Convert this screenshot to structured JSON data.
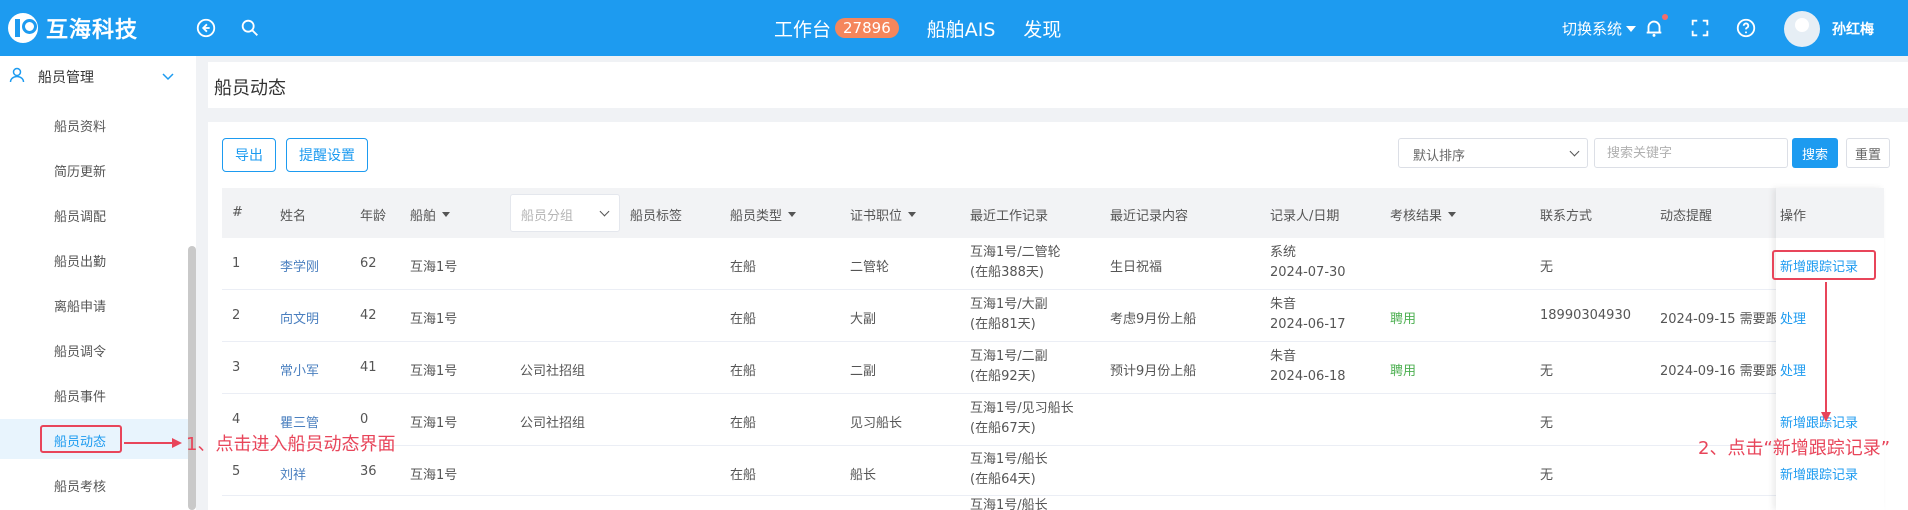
{
  "header": {
    "logo_text": "互海科技",
    "nav": [
      {
        "label": "工作台",
        "badge": "27896"
      },
      {
        "label": "船舶AIS"
      },
      {
        "label": "发现"
      }
    ],
    "switch_system": "切换系统",
    "username": "孙红梅"
  },
  "sidebar": {
    "group_label": "船员管理",
    "items": [
      {
        "label": "船员资料"
      },
      {
        "label": "简历更新"
      },
      {
        "label": "船员调配"
      },
      {
        "label": "船员出勤"
      },
      {
        "label": "离船申请"
      },
      {
        "label": "船员调令"
      },
      {
        "label": "船员事件"
      },
      {
        "label": "船员动态",
        "active": true
      },
      {
        "label": "船员考核"
      }
    ]
  },
  "page": {
    "title": "船员动态"
  },
  "toolbar": {
    "export_label": "导出",
    "reminder_label": "提醒设置",
    "sort_value": "默认排序",
    "search_placeholder": "搜索关键字",
    "search_label": "搜索",
    "reset_label": "重置"
  },
  "table": {
    "headers": {
      "index": "#",
      "name": "姓名",
      "age": "年龄",
      "ship": "船舶",
      "group_placeholder": "船员分组",
      "tag": "船员标签",
      "crew_type": "船员类型",
      "cert_position": "证书职位",
      "recent_work": "最近工作记录",
      "recent_content": "最近记录内容",
      "recorder_date": "记录人/日期",
      "result": "考核结果",
      "contact": "联系方式",
      "reminder": "动态提醒",
      "actions": "操作"
    },
    "rows": [
      {
        "index": "1",
        "name": "李学刚",
        "age": "62",
        "ship": "互海1号",
        "group": "",
        "tag": "",
        "crew_type": "在船",
        "cert_position": "二管轮",
        "work_line1": "互海1号/二管轮",
        "work_line2": "(在船388天)",
        "content": "生日祝福",
        "recorder": "系统",
        "date": "2024-07-30",
        "result": "",
        "contact": "无",
        "reminder": "",
        "action": "新增跟踪记录"
      },
      {
        "index": "2",
        "name": "向文明",
        "age": "42",
        "ship": "互海1号",
        "group": "",
        "tag": "",
        "crew_type": "在船",
        "cert_position": "大副",
        "work_line1": "互海1号/大副",
        "work_line2": "(在船81天)",
        "content": "考虑9月份上船",
        "recorder": "朱音",
        "date": "2024-06-17",
        "result": "聘用",
        "contact": "18990304930",
        "reminder": "2024-09-15 需要跟",
        "action": "处理"
      },
      {
        "index": "3",
        "name": "常小军",
        "age": "41",
        "ship": "互海1号",
        "group": "公司社招组",
        "tag": "",
        "crew_type": "在船",
        "cert_position": "二副",
        "work_line1": "互海1号/二副",
        "work_line2": "(在船92天)",
        "content": "预计9月份上船",
        "recorder": "朱音",
        "date": "2024-06-18",
        "result": "聘用",
        "contact": "无",
        "reminder": "2024-09-16 需要跟",
        "action": "处理"
      },
      {
        "index": "4",
        "name": "瞿三管",
        "age": "0",
        "ship": "互海1号",
        "group": "公司社招组",
        "tag": "",
        "crew_type": "在船",
        "cert_position": "见习船长",
        "work_line1": "互海1号/见习船长",
        "work_line2": "(在船67天)",
        "content": "",
        "recorder": "",
        "date": "",
        "result": "",
        "contact": "无",
        "reminder": "",
        "action": "新增跟踪记录"
      },
      {
        "index": "5",
        "name": "刘祥",
        "age": "36",
        "ship": "互海1号",
        "group": "",
        "tag": "",
        "crew_type": "在船",
        "cert_position": "船长",
        "work_line1": "互海1号/船长",
        "work_line2": "(在船64天)",
        "content": "",
        "recorder": "",
        "date": "",
        "result": "",
        "contact": "无",
        "reminder": "",
        "action": "新增跟踪记录"
      },
      {
        "index": "",
        "name": "",
        "age": "",
        "ship": "",
        "group": "",
        "tag": "",
        "crew_type": "",
        "cert_position": "",
        "work_line1": "互海1号/船长",
        "work_line2": "",
        "content": "",
        "recorder": "",
        "date": "",
        "result": "",
        "contact": "",
        "reminder": "",
        "action": ""
      }
    ]
  },
  "annotations": {
    "step1": "1、点击进入船员动态界面",
    "step2": "2、点击“新增跟踪记录”",
    "color": "#e8455a"
  },
  "colors": {
    "primary": "#1d9bf0",
    "badge": "#f5865c",
    "success": "#4caf50",
    "link": "#4a7fbf"
  }
}
